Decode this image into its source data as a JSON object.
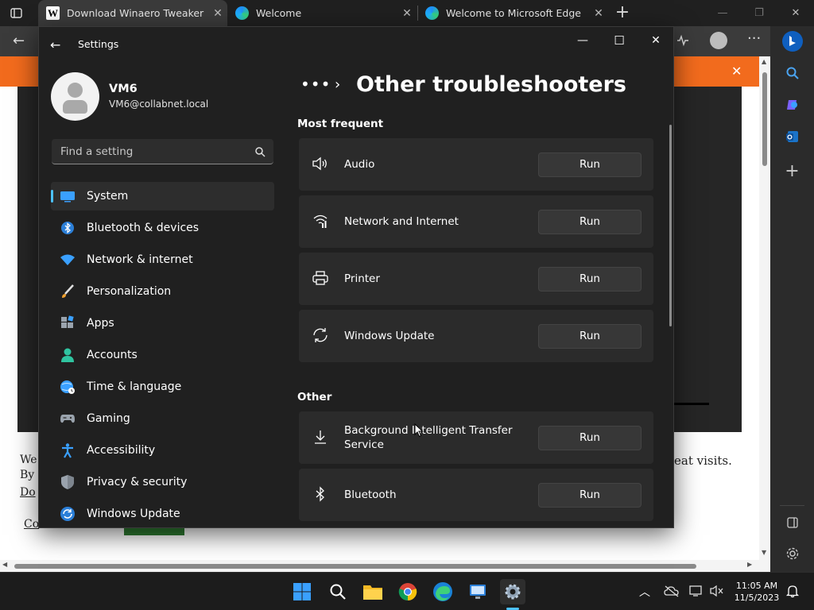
{
  "browser": {
    "tabs": [
      {
        "title": "Download Winaero Tweaker",
        "favicon": "winaero-icon",
        "active": true
      },
      {
        "title": "Welcome",
        "favicon": "edge-icon",
        "active": false
      },
      {
        "title": "Welcome to Microsoft Edge",
        "favicon": "edge-icon",
        "active": false
      }
    ],
    "tab_close_glyph": "✕",
    "new_tab_glyph": "+"
  },
  "webpage": {
    "text_fragments": [
      "We",
      "By",
      "Do",
      "eat visits.",
      "Co"
    ]
  },
  "settings": {
    "window_title": "Settings",
    "user": {
      "name": "VM6",
      "email": "VM6@collabnet.local"
    },
    "search_placeholder": "Find a setting",
    "nav": [
      {
        "label": "System",
        "icon": "system-icon",
        "selected": true
      },
      {
        "label": "Bluetooth & devices",
        "icon": "bluetooth-devices-icon"
      },
      {
        "label": "Network & internet",
        "icon": "network-wifi-icon"
      },
      {
        "label": "Personalization",
        "icon": "brush-icon"
      },
      {
        "label": "Apps",
        "icon": "apps-icon"
      },
      {
        "label": "Accounts",
        "icon": "accounts-icon"
      },
      {
        "label": "Time & language",
        "icon": "globe-clock-icon"
      },
      {
        "label": "Gaming",
        "icon": "gamepad-icon"
      },
      {
        "label": "Accessibility",
        "icon": "accessibility-icon"
      },
      {
        "label": "Privacy & security",
        "icon": "shield-icon"
      },
      {
        "label": "Windows Update",
        "icon": "windows-update-icon"
      }
    ],
    "breadcrumb_dots": "•••",
    "breadcrumb_sep": "›",
    "page_title": "Other troubleshooters",
    "sections": [
      {
        "heading": "Most frequent",
        "items": [
          {
            "label": "Audio",
            "icon": "speaker-icon",
            "button": "Run"
          },
          {
            "label": "Network and Internet",
            "icon": "network-signal-icon",
            "button": "Run"
          },
          {
            "label": "Printer",
            "icon": "printer-icon",
            "button": "Run"
          },
          {
            "label": "Windows Update",
            "icon": "sync-icon",
            "button": "Run"
          }
        ]
      },
      {
        "heading": "Other",
        "items": [
          {
            "label": "Background Intelligent Transfer Service",
            "icon": "download-icon",
            "button": "Run"
          },
          {
            "label": "Bluetooth",
            "icon": "bluetooth-icon",
            "button": "Run"
          }
        ]
      }
    ]
  },
  "taskbar": {
    "time": "11:05 AM",
    "date": "11/5/2023",
    "apps": [
      "windows-start-icon",
      "search-icon",
      "file-explorer-icon",
      "chrome-icon",
      "edge-icon",
      "remote-desktop-icon",
      "settings-gear-icon"
    ]
  },
  "colors": {
    "accent": "#4cc2ff",
    "orange_banner": "#f26b1d",
    "settings_bg": "#202020",
    "card_bg": "#2b2b2b"
  }
}
